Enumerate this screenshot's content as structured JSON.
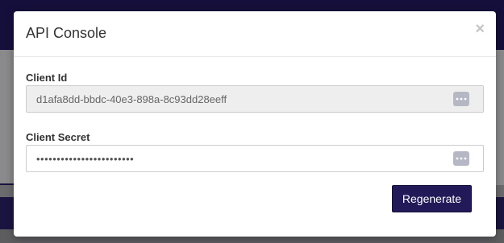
{
  "modal": {
    "title": "API Console",
    "close_symbol": "×"
  },
  "client_id": {
    "label": "Client Id",
    "value": "d1afa8dd-bbdc-40e3-898a-8c93dd28eeff",
    "icon": "more-dots-icon"
  },
  "client_secret": {
    "label": "Client Secret",
    "value": "••••••••••••••••••••••••",
    "icon": "more-dots-icon"
  },
  "actions": {
    "regenerate_label": "Regenerate"
  },
  "colors": {
    "primary_button": "#221a58",
    "topbar": "#150f3b",
    "readonly_field": "#eeeeee",
    "icon_badge": "#b5b8c4"
  }
}
